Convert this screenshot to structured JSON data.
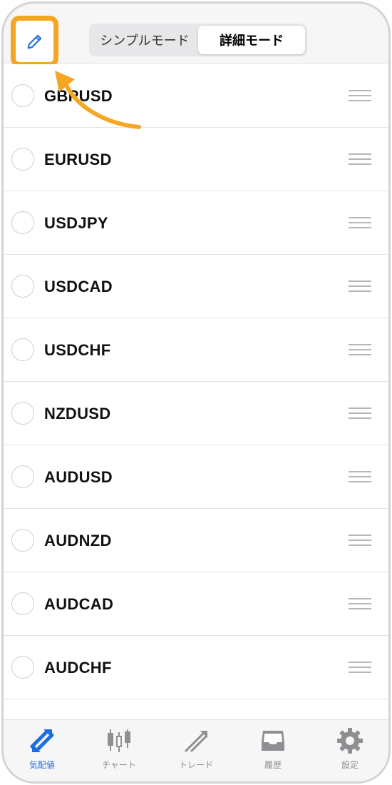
{
  "header": {
    "edit_icon": "pencil-icon",
    "segments": [
      {
        "label": "シンプルモード",
        "selected": false
      },
      {
        "label": "詳細モード",
        "selected": true
      }
    ]
  },
  "symbols": [
    {
      "name": "GBPUSD"
    },
    {
      "name": "EURUSD"
    },
    {
      "name": "USDJPY"
    },
    {
      "name": "USDCAD"
    },
    {
      "name": "USDCHF"
    },
    {
      "name": "NZDUSD"
    },
    {
      "name": "AUDUSD"
    },
    {
      "name": "AUDNZD"
    },
    {
      "name": "AUDCAD"
    },
    {
      "name": "AUDCHF"
    }
  ],
  "tabs": [
    {
      "label": "気配値",
      "icon": "quotes-icon",
      "active": true
    },
    {
      "label": "チャート",
      "icon": "candlestick-icon",
      "active": false
    },
    {
      "label": "トレード",
      "icon": "trade-icon",
      "active": false
    },
    {
      "label": "履歴",
      "icon": "history-inbox-icon",
      "active": false
    },
    {
      "label": "設定",
      "icon": "gear-icon",
      "active": false
    }
  ],
  "colors": {
    "accent": "#1d6fe0",
    "highlight": "#f5a623",
    "inactive": "#8e8e93"
  }
}
